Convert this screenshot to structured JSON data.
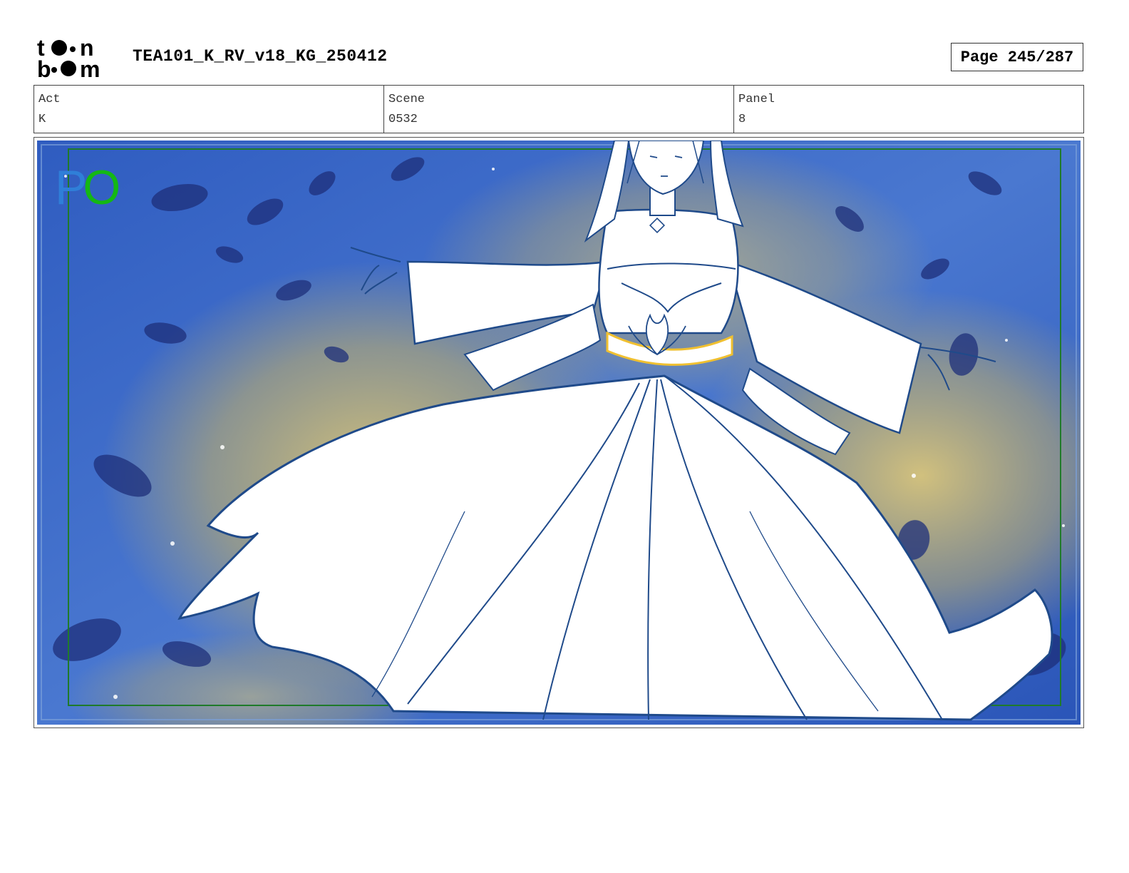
{
  "header": {
    "logo_text": "toon boom",
    "document_title": "TEA101_K_RV_v18_KG_250412",
    "page_label": "Page 245/287"
  },
  "info": {
    "act_label": "Act",
    "act_value": "K",
    "scene_label": "Scene",
    "scene_value": "0532",
    "panel_label": "Panel",
    "panel_value": "8"
  },
  "panel": {
    "corner_mark_p": "P",
    "corner_mark_o": "O"
  },
  "colors": {
    "sky_blue": "#3a64c4",
    "glow_gold": "#c9b56a",
    "lineart": "#1f4a8a",
    "safe_frame": "#1f7a2a",
    "sash": "#f0c030"
  }
}
